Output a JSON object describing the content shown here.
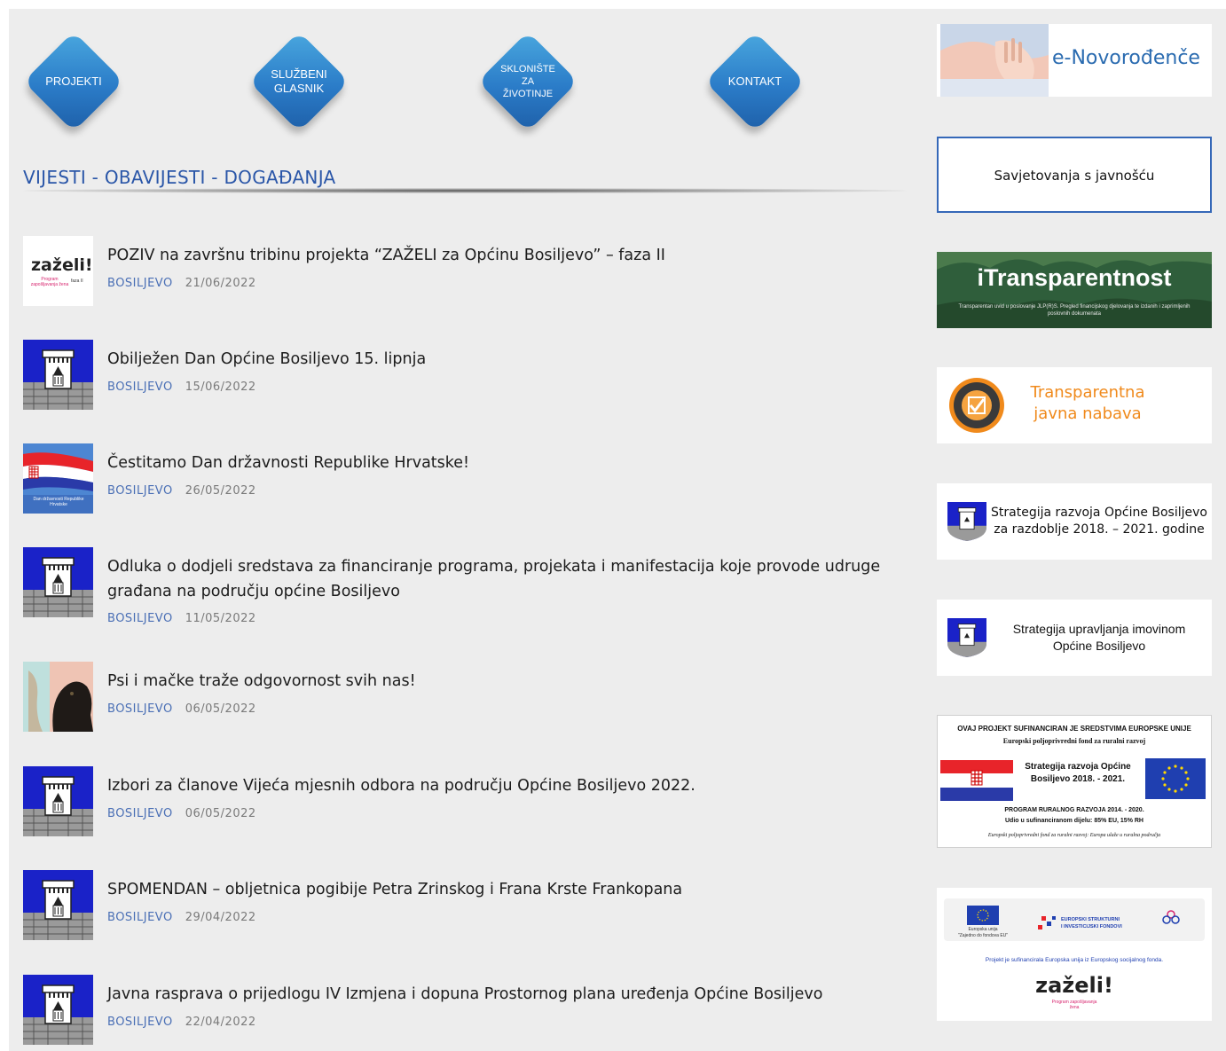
{
  "nav": [
    {
      "label": "PROJEKTI"
    },
    {
      "label": "SLUŽBENI\nGLASNIK"
    },
    {
      "label": "SKLONIŠTE\nZA\nŽIVOTINJE"
    },
    {
      "label": "KONTAKT"
    }
  ],
  "section_title": "VIJESTI - OBAVIJESTI - DOGAĐANJA",
  "news": [
    {
      "title": "POZIV na završnu tribinu projekta “ZAŽELI za Općinu Bosiljevo” – faza II",
      "category": "BOSILJEVO",
      "date": "21/06/2022"
    },
    {
      "title": "Obilježen Dan Općine Bosiljevo 15. lipnja",
      "category": "BOSILJEVO",
      "date": "15/06/2022"
    },
    {
      "title": "Čestitamo Dan državnosti Republike Hrvatske!",
      "category": "BOSILJEVO",
      "date": "26/05/2022"
    },
    {
      "title": "Odluka o dodjeli sredstava za financiranje programa, projekata i manifestacija koje provode udruge građana na području općine Bosiljevo",
      "category": "BOSILJEVO",
      "date": "11/05/2022"
    },
    {
      "title": "Psi i mačke traže odgovornost svih nas!",
      "category": "BOSILJEVO",
      "date": "06/05/2022"
    },
    {
      "title": "Izbori za članove Vijeća mjesnih odbora na području Općine Bosiljevo 2022.",
      "category": "BOSILJEVO",
      "date": "06/05/2022"
    },
    {
      "title": "SPOMENDAN – obljetnica pogibije Petra Zrinskog i Frana Krste Frankopana",
      "category": "BOSILJEVO",
      "date": "29/04/2022"
    },
    {
      "title": "Javna rasprava o prijedlogu IV Izmjena i dopuna Prostornog plana uređenja Općine Bosiljevo",
      "category": "BOSILJEVO",
      "date": "22/04/2022"
    }
  ],
  "zazeli_thumb": {
    "logo": "zaželi!",
    "sub": "Program zapošljavanja žena",
    "phase": "faza II"
  },
  "flag_thumb": {
    "caption": "Dan državnosti Republike Hrvatske"
  },
  "banners": {
    "enovorodjence": "e-Novorođenče",
    "savjetovanja": "Savjetovanja s javnošću",
    "itransparentnost": {
      "title": "iTransparentnost",
      "sub": "Transparentan uvid u poslovanje JLP(R)S. Pregled financijskog djelovanja te izdanih i zaprimljenih poslovnih dokumenata"
    },
    "nabava": {
      "line1": "Transparentna",
      "line2": "javna nabava",
      "seal": "TRANSPARENTNA JAVNA NABAVA"
    },
    "strategija_razvoja": {
      "line1": "Strategija razvoja Općine Bosiljevo",
      "line2": "za razdoblje 2018. – 2021. godine"
    },
    "strategija_imovine": {
      "line1": "Strategija upravljanja imovinom",
      "line2": "Općine Bosiljevo"
    },
    "eu": {
      "top": "OVAJ PROJEKT SUFINANCIRAN JE SREDSTVIMA EUROPSKE UNIJE",
      "fund": "Europski poljoprivredni fond za ruralni razvoj",
      "mid1": "Strategija razvoja Općine",
      "mid2": "Bosiljevo 2018. - 2021.",
      "prog": "PROGRAM RURALNOG RAZVOJA 2014. - 2020.",
      "share": "Udio u sufinanciranom dijelu: 85% EU, 15% RH",
      "bottom": "Europski poljoprivredni fond za ruralni razvoj: Europa ulaže u ruralna područja"
    },
    "esf": {
      "eu_label": "Europska unija",
      "eu_sub": "\"Zajedno do fondova EU\"",
      "esi1": "EUROPSKI STRUKTURNI",
      "esi2": "I INVESTICIJSKI FONDOVI",
      "text": "Projekt je sufinancirala Europska unija iz Europskog socijalnog fonda.",
      "logo": "zaželi!",
      "sub": "Program zapošljavanja žena"
    }
  },
  "colors": {
    "accent": "#2a56a8",
    "diamond": "#2b7cc8",
    "background": "#ededed"
  }
}
